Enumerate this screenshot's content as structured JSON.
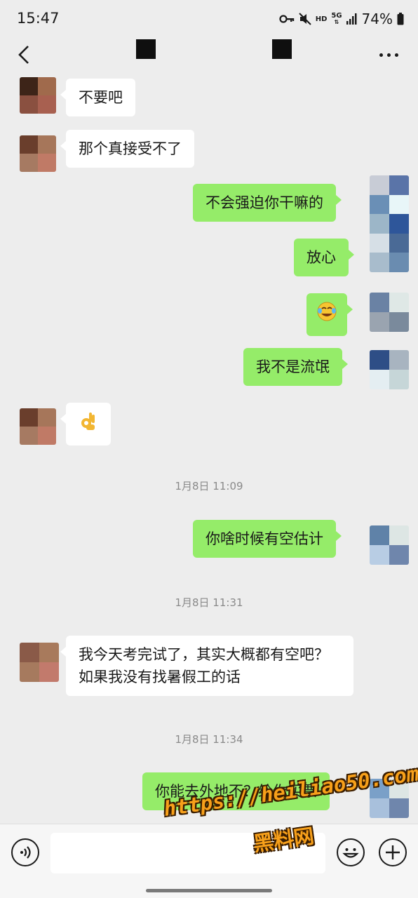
{
  "status_bar": {
    "time": "15:47",
    "hd_label": "HD",
    "network_label": "5G",
    "battery_percent": "74%"
  },
  "messages": [
    {
      "side": "in",
      "text": "不要吧"
    },
    {
      "side": "in",
      "text": "那个真接受不了"
    },
    {
      "side": "out",
      "text": "不会强迫你干嘛的"
    },
    {
      "side": "out",
      "text": "放心"
    },
    {
      "side": "out",
      "text": "",
      "emoji": "rolling-laughing-emoji"
    },
    {
      "side": "out",
      "text": "我不是流氓"
    },
    {
      "side": "in",
      "text": "",
      "emoji": "ok-hand-emoji"
    },
    {
      "side": "out",
      "text": "你啥时候有空估计"
    },
    {
      "side": "in",
      "text": "我今天考完试了，其实大概都有空吧？如果我没有找暑假工的话"
    },
    {
      "side": "out",
      "text": "你能去外地不？给你买票"
    }
  ],
  "timestamps": [
    "1月8日 11:09",
    "1月8日 11:31",
    "1月8日 11:34"
  ],
  "input_bar": {
    "value": "",
    "icons": [
      "voice-icon",
      "emoji-icon",
      "plus-icon"
    ]
  },
  "watermark": {
    "url": "https://heiliao50.com",
    "name": "黑料网"
  },
  "colors": {
    "background": "#ededed",
    "incoming_bubble": "#ffffff",
    "outgoing_bubble": "#95ec69",
    "watermark": "#f7a01a"
  }
}
